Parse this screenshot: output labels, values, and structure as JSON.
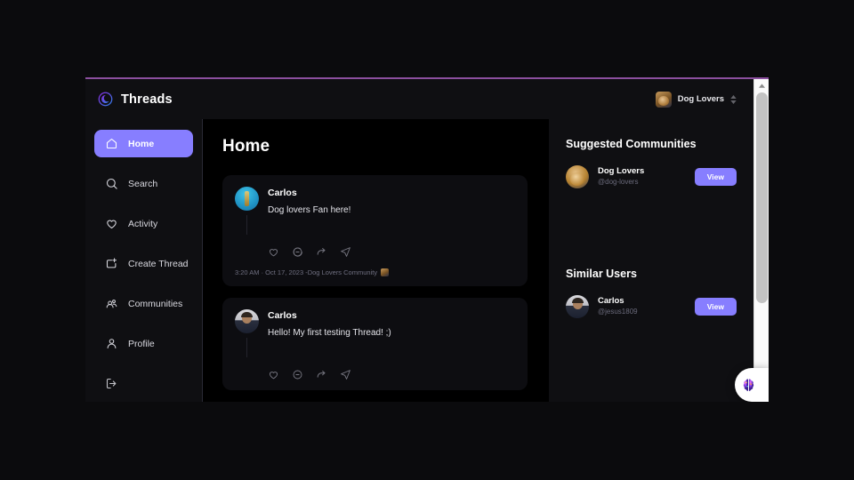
{
  "app": {
    "brand_name": "Threads",
    "logo_icon": "threads-logo-icon"
  },
  "topbar": {
    "user_name": "Dog Lovers",
    "switcher_icon": "up-down-chevron-icon",
    "avatar_icon": "dog-avatar"
  },
  "sidebar": {
    "items": [
      {
        "label": "Home",
        "icon": "home-icon",
        "active": true
      },
      {
        "label": "Search",
        "icon": "search-icon",
        "active": false
      },
      {
        "label": "Activity",
        "icon": "heart-icon",
        "active": false
      },
      {
        "label": "Create Thread",
        "icon": "create-icon",
        "active": false
      },
      {
        "label": "Communities",
        "icon": "people-icon",
        "active": false
      },
      {
        "label": "Profile",
        "icon": "person-icon",
        "active": false
      },
      {
        "label": "",
        "icon": "logout-icon",
        "active": false
      }
    ]
  },
  "main": {
    "title": "Home",
    "posts": [
      {
        "author": "Carlos",
        "text": "Dog lovers Fan here!",
        "meta": "3:20 AM · Oct 17, 2023 -Dog Lovers Community",
        "avatar": "bottle-avatar",
        "has_meta": true,
        "actions": [
          "heart-icon",
          "comment-icon",
          "repost-icon",
          "send-icon"
        ]
      },
      {
        "author": "Carlos",
        "text": "Hello! My first testing Thread! ;)",
        "meta": "",
        "avatar": "man-avatar",
        "has_meta": false,
        "actions": [
          "heart-icon",
          "comment-icon",
          "repost-icon",
          "send-icon"
        ]
      }
    ]
  },
  "right_panel": {
    "communities_title": "Suggested Communities",
    "communities": [
      {
        "name": "Dog Lovers",
        "handle": "@dog-lovers",
        "button": "View",
        "avatar": "dog-avatar"
      }
    ],
    "users_title": "Similar Users",
    "users": [
      {
        "name": "Carlos",
        "handle": "@jesus1809",
        "button": "View",
        "avatar": "man-avatar"
      }
    ]
  },
  "assistant": {
    "icon": "brain-assistant-icon"
  },
  "colors": {
    "accent": "#877eff",
    "panel": "#0f0f12",
    "canvas": "#000000",
    "card": "#0d0d11",
    "top_accent": "#8b4f9e",
    "muted_text": "#6b6b7c"
  }
}
